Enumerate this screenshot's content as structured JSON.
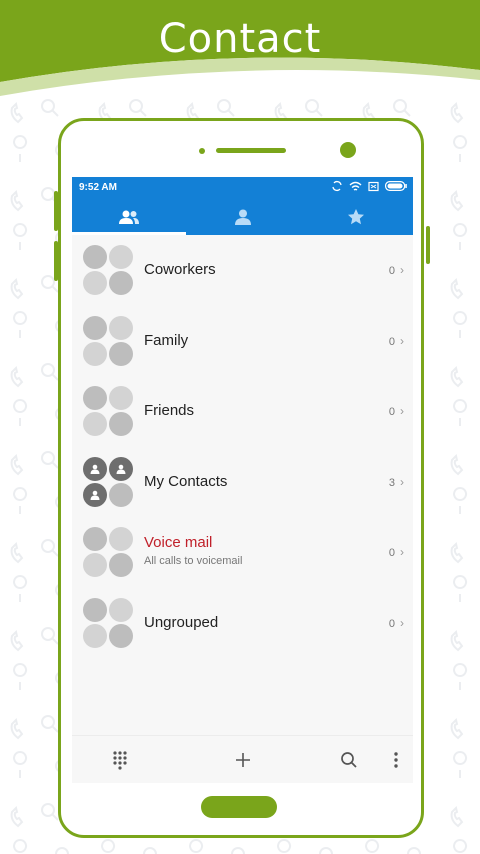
{
  "banner": {
    "title": "Contact",
    "color": "#7aa51b"
  },
  "status_bar": {
    "time": "9:52 AM"
  },
  "tabs": [
    {
      "icon": "groups-icon",
      "active": true
    },
    {
      "icon": "person-icon",
      "active": false
    },
    {
      "icon": "star-icon",
      "active": false
    }
  ],
  "groups": [
    {
      "name": "Coworkers",
      "count": "0",
      "subtitle": "",
      "avatar": "placeholder"
    },
    {
      "name": "Family",
      "count": "0",
      "subtitle": "",
      "avatar": "placeholder"
    },
    {
      "name": "Friends",
      "count": "0",
      "subtitle": "",
      "avatar": "placeholder"
    },
    {
      "name": "My Contacts",
      "count": "3",
      "subtitle": "",
      "avatar": "people"
    },
    {
      "name": "Voice mail",
      "count": "0",
      "subtitle": "All calls to voicemail",
      "avatar": "placeholder",
      "name_color": "#c0202a"
    },
    {
      "name": "Ungrouped",
      "count": "0",
      "subtitle": "",
      "avatar": "placeholder"
    }
  ],
  "bottom_bar": {
    "items": [
      "dialpad-icon",
      "add-icon",
      "search-icon",
      "more-icon"
    ]
  },
  "colors": {
    "accent": "#1380d6",
    "brand": "#7aa51b"
  }
}
